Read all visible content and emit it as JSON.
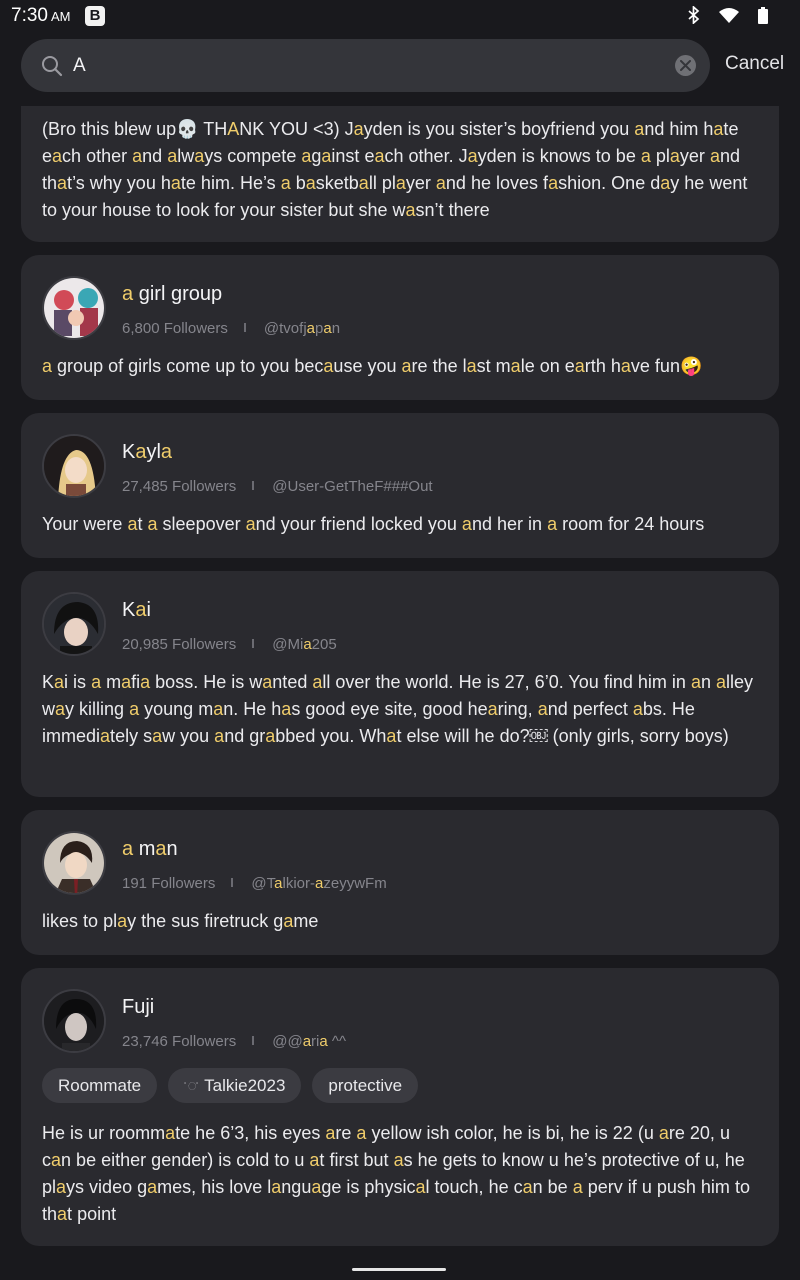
{
  "status": {
    "time": "7:30",
    "ampm": "AM",
    "badge": "B"
  },
  "search": {
    "query": "A"
  },
  "cancel_label": "Cancel",
  "cards": [
    {
      "desc": "(Bro this blew up💀 THANK YOU <3) Jayden is you sister’s boyfriend you and him hate each other and always compete against each other. Jayden is knows to be a player and that’s why you hate him. He’s a basketball player and he loves fashion. One day he went to your house to look for your sister but she wasn’t there"
    },
    {
      "name": "a girl group",
      "followers": "6,800 Followers",
      "handle": "@tvofjapan",
      "desc": "a group of girls come up to you because you are the last male on earth have fun🤪"
    },
    {
      "name": "Kayla",
      "followers": "27,485 Followers",
      "handle": "@User-GetTheF###Out",
      "desc": "Your were at a sleepover and your friend locked you and her in a room for  24 hours"
    },
    {
      "name": "Kai",
      "followers": "20,985 Followers",
      "handle": "@Mia205",
      "desc": "Kai is a mafia boss. He is wanted all over the world. He is 27, 6’0. You find him in an alley way killing a young man. He has good eye site, good hearing, and perfect abs. He immediately saw you and grabbed you. What else will he do?￼ (only girls, sorry boys)"
    },
    {
      "name": "a man",
      "followers": "191 Followers",
      "handle": "@Talkior-azeyywFm",
      "desc": "likes to play the sus firetruck game"
    },
    {
      "name": "Fuji",
      "followers": "23,746 Followers",
      "handle": "@@aria ^^",
      "tags": [
        "Roommate",
        "Talkie2023",
        "protective"
      ],
      "tag_prefix": "ﾟ◌ﾟ",
      "desc": "He is ur roommate he 6’3, his eyes are a yellow ish color, he is bi, he is 22 (u are 20, u can be either gender) is cold to u at first but as he gets to know u he’s protective of u, he plays video games, his love language is physical touch, he can be a perv if u push him to that point"
    }
  ],
  "colors": {
    "highlight": "#f0cd6b",
    "card": "#2a2a2f",
    "background": "#19191d"
  }
}
